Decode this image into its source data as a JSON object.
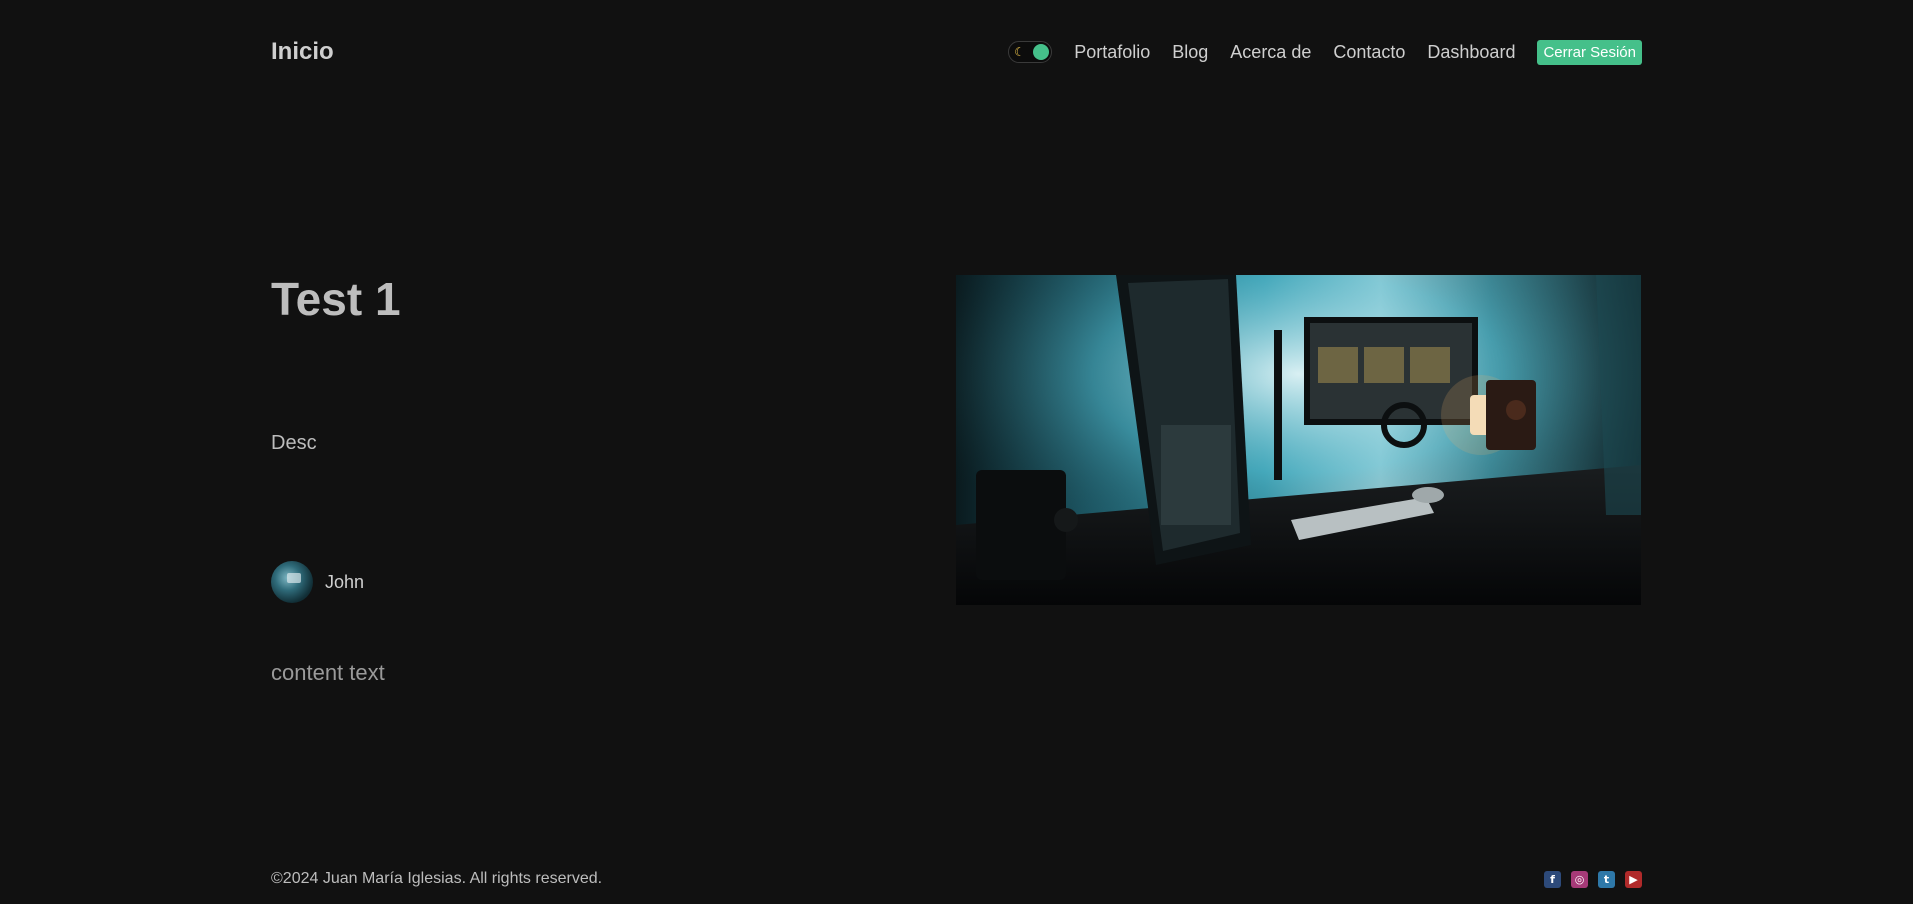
{
  "header": {
    "brand": "Inicio",
    "theme_toggle": {
      "icon": "moon-icon",
      "state": "dark",
      "accent": "#45c08a"
    },
    "nav": [
      {
        "label": "Portafolio"
      },
      {
        "label": "Blog"
      },
      {
        "label": "Acerca de"
      },
      {
        "label": "Contacto"
      },
      {
        "label": "Dashboard"
      }
    ],
    "logout_label": "Cerrar Sesión"
  },
  "post": {
    "title": "Test 1",
    "description": "Desc",
    "author": {
      "name": "John"
    },
    "content": "content text",
    "image": {
      "subject": "desk setup with monitors in teal light"
    }
  },
  "footer": {
    "copyright": "©2024 Juan María Iglesias. All rights reserved.",
    "socials": [
      {
        "name": "facebook-icon",
        "glyph": "f",
        "color": "#2d4a7a"
      },
      {
        "name": "instagram-icon",
        "glyph": "◎",
        "color": "#a63a78"
      },
      {
        "name": "twitter-icon",
        "glyph": "t",
        "color": "#2e78a8"
      },
      {
        "name": "youtube-icon",
        "glyph": "▶",
        "color": "#b02a2a"
      }
    ]
  },
  "colors": {
    "background": "#111111",
    "accent": "#45c08a",
    "text": "#cfcfcf"
  }
}
